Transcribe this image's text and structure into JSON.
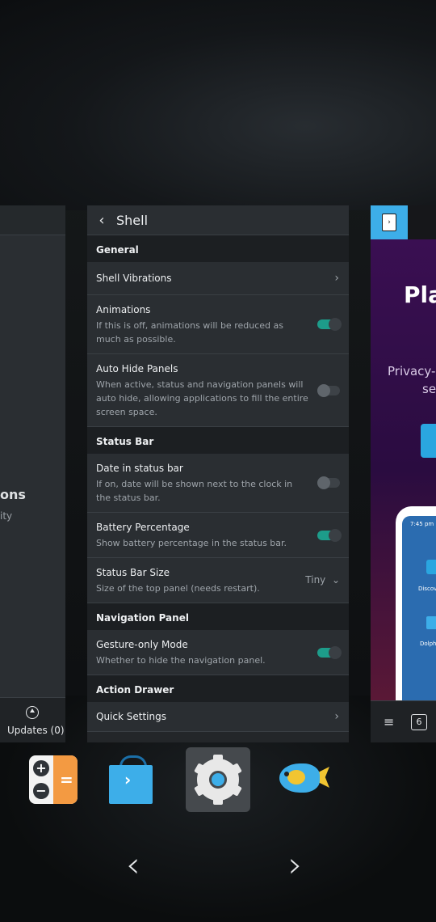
{
  "left_card": {
    "fragment_title": "ons",
    "fragment_sub": "ity",
    "updates_label": "Updates (0)"
  },
  "settings": {
    "back_glyph": "‹",
    "title": "Shell",
    "sections": {
      "general": "General",
      "status_bar": "Status Bar",
      "navigation_panel": "Navigation Panel",
      "action_drawer": "Action Drawer"
    },
    "items": {
      "shell_vibrations": {
        "title": "Shell Vibrations"
      },
      "animations": {
        "title": "Animations",
        "desc": "If this is off, animations will be reduced as much as possible.",
        "on": true
      },
      "auto_hide": {
        "title": "Auto Hide Panels",
        "desc": "When active, status and navigation panels will auto hide, allowing applications to fill the entire screen space.",
        "on": false
      },
      "date_status": {
        "title": "Date in status bar",
        "desc": "If on, date will be shown next to the clock in the status bar.",
        "on": false
      },
      "battery": {
        "title": "Battery Percentage",
        "desc": "Show battery percentage in the status bar.",
        "on": true
      },
      "status_size": {
        "title": "Status Bar Size",
        "desc": "Size of the top panel (needs restart).",
        "value": "Tiny"
      },
      "gesture": {
        "title": "Gesture-only Mode",
        "desc": "Whether to hide the navigation panel.",
        "on": true
      },
      "quick_settings": {
        "title": "Quick Settings"
      }
    }
  },
  "right_card": {
    "heading": "Pla",
    "line1": "Privacy-",
    "line2": "se",
    "phone_time": "7:45 pm",
    "phone_label1": "Discov",
    "phone_label2": "Dolph",
    "tab_count": "6"
  },
  "nav": {
    "prev": "‹",
    "next": "›"
  },
  "colors": {
    "accent": "#1d9c8a",
    "blue": "#3daee9"
  }
}
